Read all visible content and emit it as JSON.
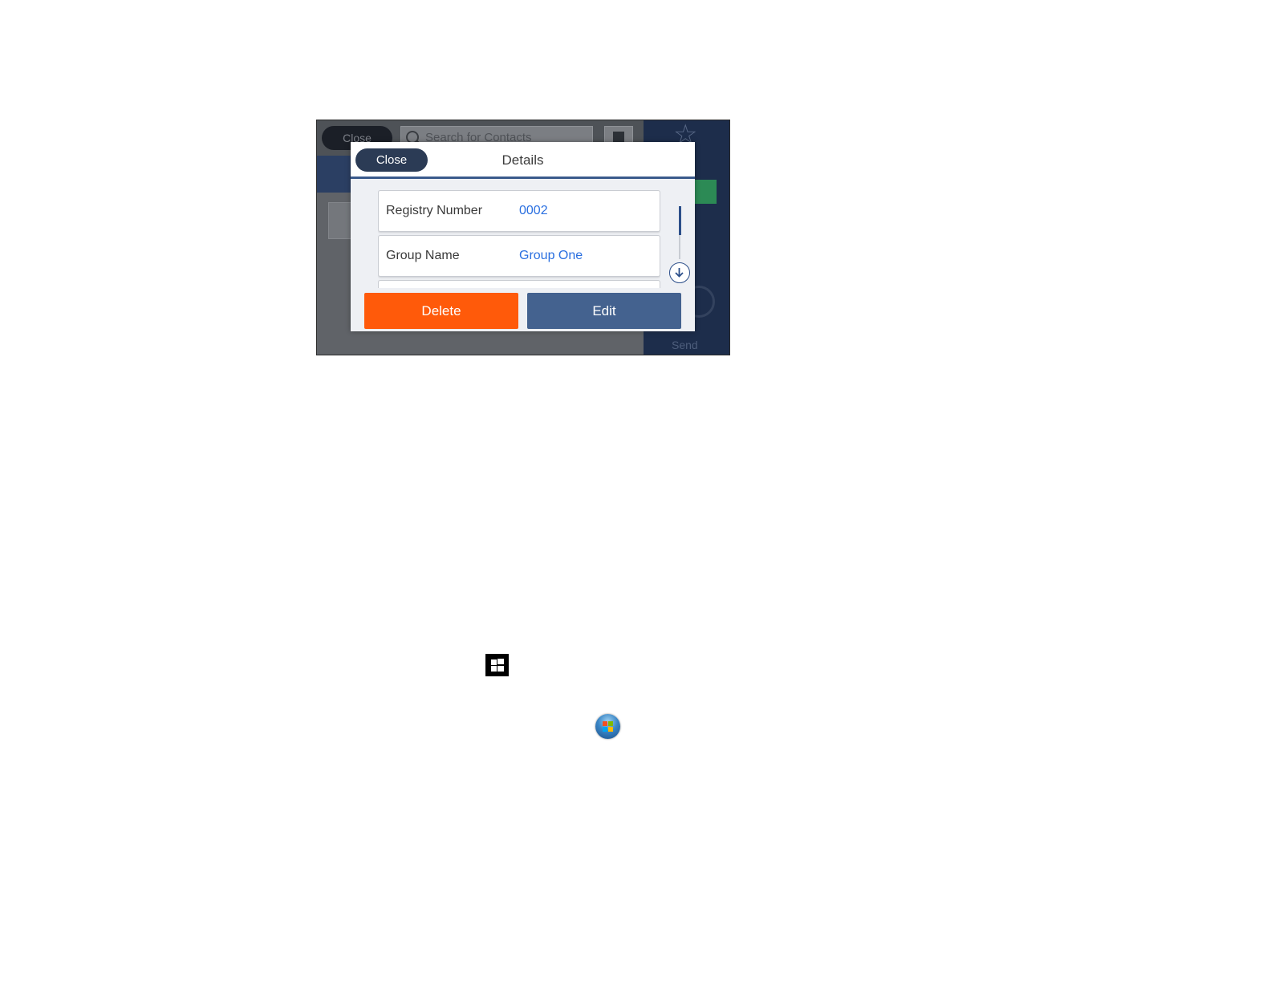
{
  "background_screen": {
    "close_label": "Close",
    "search_placeholder": "Search for Contacts",
    "send_label": "Send"
  },
  "dialog": {
    "close_label": "Close",
    "title": "Details",
    "rows": [
      {
        "label": "Registry Number",
        "value": "0002"
      },
      {
        "label": "Group Name",
        "value": "Group One"
      }
    ],
    "delete_label": "Delete",
    "edit_label": "Edit"
  },
  "colors": {
    "delete": "#ff5a0a",
    "edit": "#44628f",
    "value_text": "#2a6fe0",
    "header_accent": "#3a5a8c"
  },
  "icons": {
    "windows8_start": "windows-logo-icon",
    "windows7_start": "windows-orb-icon",
    "scroll_down": "arrow-down-circle-icon"
  }
}
